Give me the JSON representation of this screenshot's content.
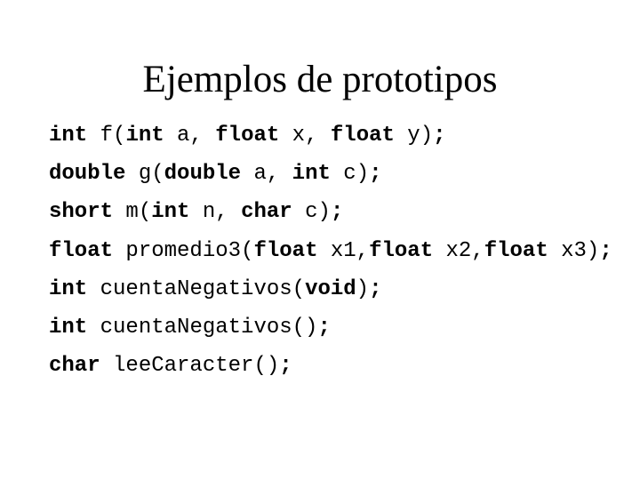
{
  "slide": {
    "title": "Ejemplos de prototipos",
    "lines": [
      [
        {
          "t": "int",
          "b": true
        },
        {
          "t": " f(",
          "b": false
        },
        {
          "t": "int",
          "b": true
        },
        {
          "t": " a, ",
          "b": false
        },
        {
          "t": "float",
          "b": true
        },
        {
          "t": " x, ",
          "b": false
        },
        {
          "t": "float",
          "b": true
        },
        {
          "t": " y)",
          "b": false
        },
        {
          "t": ";",
          "b": true
        }
      ],
      [
        {
          "t": "double",
          "b": true
        },
        {
          "t": " g(",
          "b": false
        },
        {
          "t": "double",
          "b": true
        },
        {
          "t": " a, ",
          "b": false
        },
        {
          "t": "int",
          "b": true
        },
        {
          "t": " c)",
          "b": false
        },
        {
          "t": ";",
          "b": true
        }
      ],
      [
        {
          "t": "short",
          "b": true
        },
        {
          "t": " m(",
          "b": false
        },
        {
          "t": "int",
          "b": true
        },
        {
          "t": " n, ",
          "b": false
        },
        {
          "t": "char",
          "b": true
        },
        {
          "t": " c)",
          "b": false
        },
        {
          "t": ";",
          "b": true
        }
      ],
      [
        {
          "t": "float",
          "b": true
        },
        {
          "t": " promedio3(",
          "b": false
        },
        {
          "t": "float",
          "b": true
        },
        {
          "t": " x1,",
          "b": false
        },
        {
          "t": "float",
          "b": true
        },
        {
          "t": " x2,",
          "b": false
        },
        {
          "t": "float",
          "b": true
        },
        {
          "t": " x3)",
          "b": false
        },
        {
          "t": ";",
          "b": true
        }
      ],
      [
        {
          "t": "int",
          "b": true
        },
        {
          "t": " cuentaNegativos(",
          "b": false
        },
        {
          "t": "void",
          "b": true
        },
        {
          "t": ")",
          "b": false
        },
        {
          "t": ";",
          "b": true
        }
      ],
      [
        {
          "t": "int",
          "b": true
        },
        {
          "t": " cuentaNegativos()",
          "b": false
        },
        {
          "t": ";",
          "b": true
        }
      ],
      [
        {
          "t": "char",
          "b": true
        },
        {
          "t": " leeCaracter()",
          "b": false
        },
        {
          "t": ";",
          "b": true
        }
      ]
    ]
  }
}
